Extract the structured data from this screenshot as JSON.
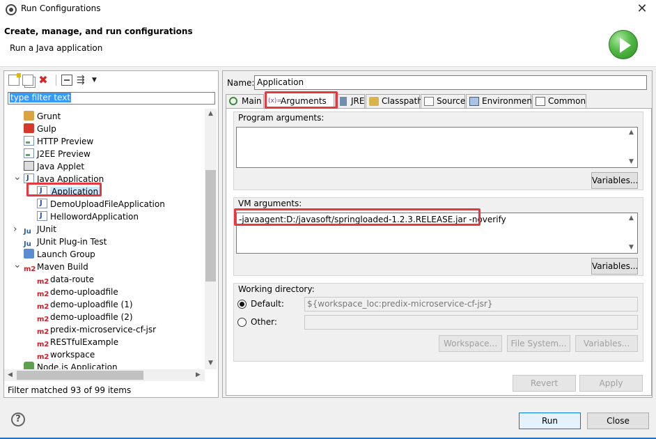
{
  "window": {
    "title": "Run Configurations",
    "close_glyph": "✕"
  },
  "header": {
    "title": "Create, manage, and run configurations",
    "subtitle": "Run a Java application",
    "icon": "run-icon"
  },
  "left_panel": {
    "toolbar": [
      "new-config-icon",
      "duplicate-icon",
      "delete-icon",
      "collapse-all-icon",
      "filter-icon",
      "dropdown-icon"
    ],
    "filter_placeholder": "type filter text",
    "tree": [
      {
        "label": "Grunt",
        "icon": "grunt-icon",
        "level": 1
      },
      {
        "label": "Gulp",
        "icon": "gulp-icon",
        "level": 1
      },
      {
        "label": "HTTP Preview",
        "icon": "page-icon",
        "level": 1
      },
      {
        "label": "J2EE Preview",
        "icon": "page-icon",
        "level": 1
      },
      {
        "label": "Java Applet",
        "icon": "applet-icon",
        "level": 1
      },
      {
        "label": "Java Application",
        "icon": "java-icon",
        "level": 1,
        "expanded": true
      },
      {
        "label": "Application",
        "icon": "java-icon",
        "level": 2,
        "selected": true
      },
      {
        "label": "DemoUploadFileApplication",
        "icon": "java-icon",
        "level": 2
      },
      {
        "label": "HellowordApplication",
        "icon": "java-icon",
        "level": 2
      },
      {
        "label": "JUnit",
        "icon": "junit-icon",
        "level": 1,
        "collapsed": true
      },
      {
        "label": "JUnit Plug-in Test",
        "icon": "junit-icon",
        "level": 1
      },
      {
        "label": "Launch Group",
        "icon": "launch-icon",
        "level": 1
      },
      {
        "label": "Maven Build",
        "icon": "m2-icon",
        "level": 1,
        "expanded": true
      },
      {
        "label": "data-route",
        "icon": "m2-icon",
        "level": 2
      },
      {
        "label": "demo-uploadfile",
        "icon": "m2-icon",
        "level": 2
      },
      {
        "label": "demo-uploadfile (1)",
        "icon": "m2-icon",
        "level": 2
      },
      {
        "label": "demo-uploadfile (2)",
        "icon": "m2-icon",
        "level": 2
      },
      {
        "label": "predix-microservice-cf-jsr",
        "icon": "m2-icon",
        "level": 2
      },
      {
        "label": "RESTfulExample",
        "icon": "m2-icon",
        "level": 2
      },
      {
        "label": "workspace",
        "icon": "m2-icon",
        "level": 2
      },
      {
        "label": "Node.js Application",
        "icon": "node-icon",
        "level": 1
      }
    ],
    "status": "Filter matched 93 of 99 items"
  },
  "right_panel": {
    "name_label": "Name:",
    "name_value": "Application",
    "tabs": [
      {
        "label": "Main",
        "icon": "main-tab-icon"
      },
      {
        "label": "Arguments",
        "icon": "arguments-tab-icon",
        "active": true
      },
      {
        "label": "JRE",
        "icon": "jre-tab-icon"
      },
      {
        "label": "Classpath",
        "icon": "classpath-tab-icon"
      },
      {
        "label": "Source",
        "icon": "source-tab-icon"
      },
      {
        "label": "Environment",
        "icon": "environment-tab-icon"
      },
      {
        "label": "Common",
        "icon": "common-tab-icon"
      }
    ],
    "program_args": {
      "label": "Program arguments:",
      "value": "",
      "variables_button": "Variables..."
    },
    "vm_args": {
      "label": "VM arguments:",
      "value": "-javaagent:D:/javasoft/springloaded-1.2.3.RELEASE.jar  -noverify",
      "variables_button": "Variables..."
    },
    "working_dir": {
      "label": "Working directory:",
      "default_label": "Default:",
      "default_value": "${workspace_loc:predix-microservice-cf-jsr}",
      "other_label": "Other:",
      "other_value": "",
      "workspace_button": "Workspace...",
      "filesystem_button": "File System...",
      "variables_button": "Variables..."
    },
    "revert_button": "Revert",
    "apply_button": "Apply"
  },
  "footer": {
    "help_glyph": "?",
    "run_button": "Run",
    "close_button": "Close"
  },
  "colors": {
    "highlight": "#e8383d",
    "selection": "#3399ff"
  }
}
